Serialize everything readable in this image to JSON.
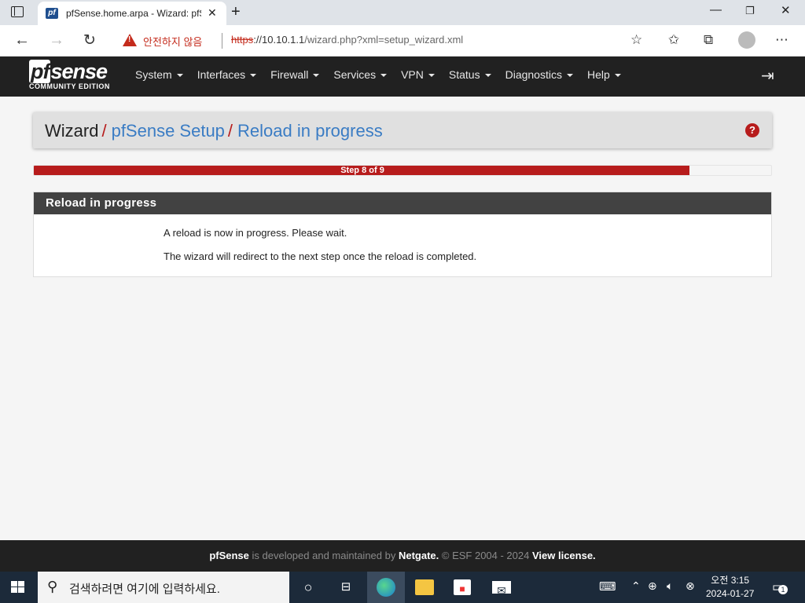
{
  "browser": {
    "tab_title": "pfSense.home.arpa - Wizard: pfSense Setup",
    "favicon_text": "pf",
    "security_warning": "안전하지 않음",
    "url_protocol": "https",
    "url_host": "://10.10.1.1",
    "url_path": "/wizard.php?xml=setup_wizard.xml"
  },
  "navbar": {
    "logo_main": "sense",
    "logo_pf": "pf",
    "logo_sub": "COMMUNITY EDITION",
    "menu": [
      "System",
      "Interfaces",
      "Firewall",
      "Services",
      "VPN",
      "Status",
      "Diagnostics",
      "Help"
    ]
  },
  "breadcrumb": {
    "root": "Wizard",
    "sep": "/",
    "level1": "pfSense Setup",
    "level2": "Reload in progress"
  },
  "progress": {
    "label": "Step 8 of 9",
    "fraction": 0.889,
    "color": "#b71c1c"
  },
  "panel": {
    "title": "Reload in progress",
    "line1": "A reload is now in progress. Please wait.",
    "line2": "The wizard will redirect to the next step once the reload is completed."
  },
  "footer": {
    "brand": "pfSense",
    "text1": " is developed and maintained by ",
    "company": "Netgate.",
    "text2": " © ESF 2004 - 2024 ",
    "license": "View license."
  },
  "taskbar": {
    "search_placeholder": "검색하려면 여기에 입력하세요.",
    "time": "오전 3:15",
    "date": "2024-01-27",
    "notification_count": "1"
  },
  "colors": {
    "accent_red": "#b71c1c",
    "link_blue": "#3a7cc4",
    "nav_dark": "#212121"
  }
}
